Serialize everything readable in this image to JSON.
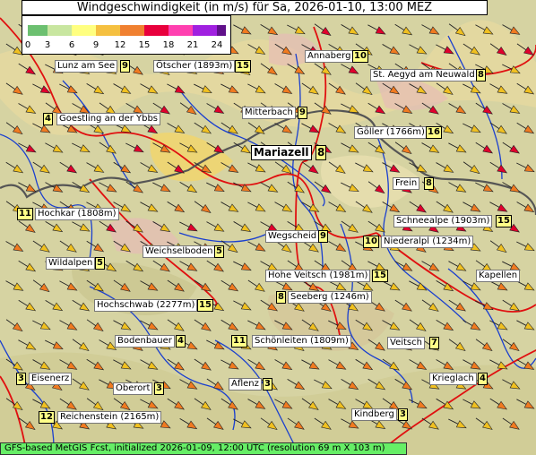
{
  "title": "Windgeschwindigkeit (in m/s) für Sa, 2026-01-10, 13:00 MEZ",
  "footer": "GFS-based MetGIS Fcst, initialized 2026-01-09, 12:00 UTC  (resolution 69 m X 103 m)",
  "legend": {
    "ticks": [
      "0",
      "3",
      "6",
      "9",
      "12",
      "15",
      "18",
      "21",
      "24"
    ],
    "colors": [
      "#6cc070",
      "#c8e6a0",
      "#ffff80",
      "#f5c040",
      "#f08030",
      "#e8003c",
      "#ff40b0",
      "#a020e0",
      "#60108a"
    ]
  },
  "colors": {
    "terrain": "#d9d6a8",
    "river": "#1a3fcf",
    "road": "#e01010",
    "border": "#555555",
    "arrow_low": "#f0c020",
    "arrow_mid": "#f07a20",
    "arrow_high": "#e0002c"
  },
  "stations": [
    {
      "name": "Lunz am See",
      "value": "9"
    },
    {
      "name": "Ötscher (1893m)",
      "value": "15"
    },
    {
      "name": "Annaberg",
      "value": "10"
    },
    {
      "name": "St. Aegyd am Neuwald",
      "value": "8"
    },
    {
      "name": "Goestling an der Ybbs",
      "value": "4"
    },
    {
      "name": "Mitterbach",
      "value": "9"
    },
    {
      "name": "Göller (1766m)",
      "value": "16"
    },
    {
      "name": "Mariazell",
      "value": "8"
    },
    {
      "name": "Frein",
      "value": "8"
    },
    {
      "name": "Hochkar (1808m)",
      "value": "11"
    },
    {
      "name": "Schneealpe (1903m)",
      "value": "15"
    },
    {
      "name": "Wegscheid",
      "value": "9"
    },
    {
      "name": "Niederalpl (1234m)",
      "value": "10"
    },
    {
      "name": "Weichselboden",
      "value": "5"
    },
    {
      "name": "Wildalpen",
      "value": "5"
    },
    {
      "name": "Kapellen",
      "value": ""
    },
    {
      "name": "Hohe Veitsch (1981m)",
      "value": "15"
    },
    {
      "name": "Seeberg (1246m)",
      "value": "8"
    },
    {
      "name": "Hochschwab (2277m)",
      "value": "15"
    },
    {
      "name": "Bodenbauer",
      "value": "4"
    },
    {
      "name": "Schönleiten (1809m)",
      "value": "11"
    },
    {
      "name": "Veitsch",
      "value": "7"
    },
    {
      "name": "Eisenerz",
      "value": "3"
    },
    {
      "name": "Oberort",
      "value": "3"
    },
    {
      "name": "Aflenz",
      "value": "3"
    },
    {
      "name": "Krieglach",
      "value": "4"
    },
    {
      "name": "Reichenstein (2165m)",
      "value": "12"
    },
    {
      "name": "Kindberg",
      "value": "3"
    }
  ]
}
